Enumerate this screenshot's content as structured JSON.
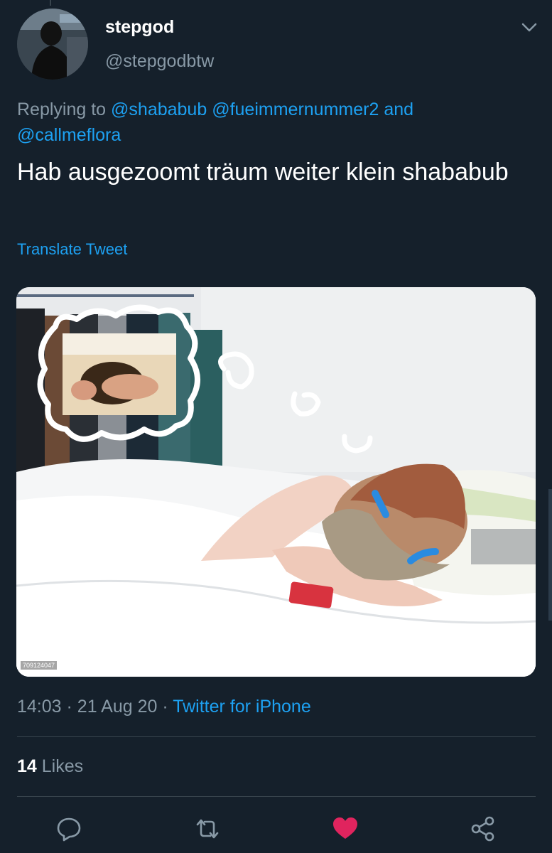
{
  "author": {
    "display_name": "stepgod",
    "handle": "@stepgodbtw"
  },
  "reply": {
    "prefix": "Replying to",
    "mention_1": "@shababub",
    "mention_2": "@fueimmernummer2",
    "conjunction": "and",
    "mention_3": "@callmeflora"
  },
  "tweet": {
    "text": "Hab ausgezoomt träum weiter klein shababub",
    "translate_label": "Translate Tweet",
    "watermark": "709124047"
  },
  "meta": {
    "time": "14:03",
    "date": "21 Aug 20",
    "source": "Twitter for iPhone"
  },
  "stats": {
    "likes_count": "14",
    "likes_label": "Likes"
  },
  "colors": {
    "background": "#15202b",
    "accent": "#1da1f2",
    "secondary_text": "#8899a6",
    "like": "#e0245e"
  },
  "icons": {
    "more": "chevron-down-icon",
    "reply": "reply-icon",
    "retweet": "retweet-icon",
    "like": "heart-icon",
    "share": "share-icon"
  }
}
